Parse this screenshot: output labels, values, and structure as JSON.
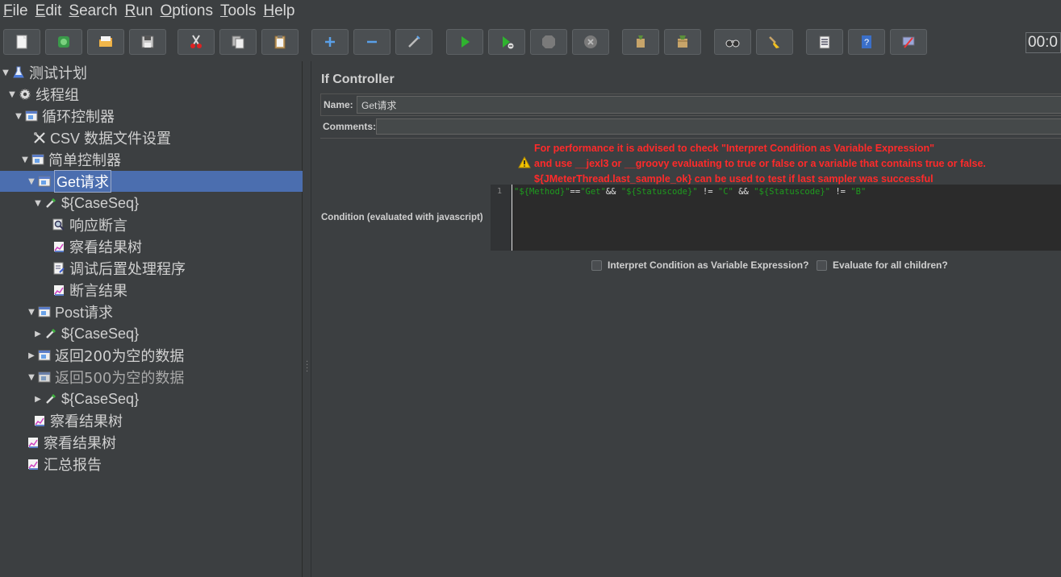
{
  "menu": {
    "items": [
      {
        "first": "F",
        "rest": "ile"
      },
      {
        "first": "E",
        "rest": "dit"
      },
      {
        "first": "S",
        "rest": "earch"
      },
      {
        "first": "R",
        "rest": "un"
      },
      {
        "first": "O",
        "rest": "ptions"
      },
      {
        "first": "T",
        "rest": "ools"
      },
      {
        "first": "H",
        "rest": "elp"
      }
    ]
  },
  "toolbar": {
    "timer": "00:0"
  },
  "tree": {
    "items": [
      {
        "label": "测试计划"
      },
      {
        "label": "线程组"
      },
      {
        "label": "循环控制器"
      },
      {
        "label": "CSV 数据文件设置"
      },
      {
        "label": "简单控制器"
      },
      {
        "label": "Get请求"
      },
      {
        "label": "${CaseSeq}"
      },
      {
        "label": "响应断言"
      },
      {
        "label": "察看结果树"
      },
      {
        "label": "调试后置处理程序"
      },
      {
        "label": "断言结果"
      },
      {
        "label": "Post请求"
      },
      {
        "label": "${CaseSeq}"
      },
      {
        "label": "返回200为空的数据"
      },
      {
        "label": "返回500为空的数据"
      },
      {
        "label": "${CaseSeq}"
      },
      {
        "label": "察看结果树"
      },
      {
        "label": "察看结果树"
      },
      {
        "label": "汇总报告"
      }
    ]
  },
  "panel": {
    "title": "If Controller",
    "name_label": "Name:",
    "name_value": "Get请求",
    "comments_label": "Comments:",
    "comments_value": "",
    "warning_lines": [
      "For performance it is advised to check \"Interpret Condition as Variable Expression\"",
      "and use __jexl3 or __groovy evaluating to true or false or a variable that contains true or false.",
      "${JMeterThread.last_sample_ok} can be used to test if last sampler was successful"
    ],
    "condition_label": "Condition (evaluated with javascript)",
    "editor": {
      "line_number": "1",
      "tokens": [
        {
          "t": "\"${Method}\"",
          "c": "s"
        },
        {
          "t": "==",
          "c": "o"
        },
        {
          "t": "\"Get\"",
          "c": "s"
        },
        {
          "t": "&& ",
          "c": "o"
        },
        {
          "t": "\"${Statuscode}\"",
          "c": "s"
        },
        {
          "t": " != ",
          "c": "o"
        },
        {
          "t": "\"C\"",
          "c": "s"
        },
        {
          "t": " && ",
          "c": "o"
        },
        {
          "t": "\"${Statuscode}\"",
          "c": "s"
        },
        {
          "t": " != ",
          "c": "o"
        },
        {
          "t": "\"B\"",
          "c": "s"
        }
      ]
    },
    "checkbox_interpret": "Interpret Condition as Variable Expression?",
    "checkbox_evaluate_all": "Evaluate for all children?"
  }
}
